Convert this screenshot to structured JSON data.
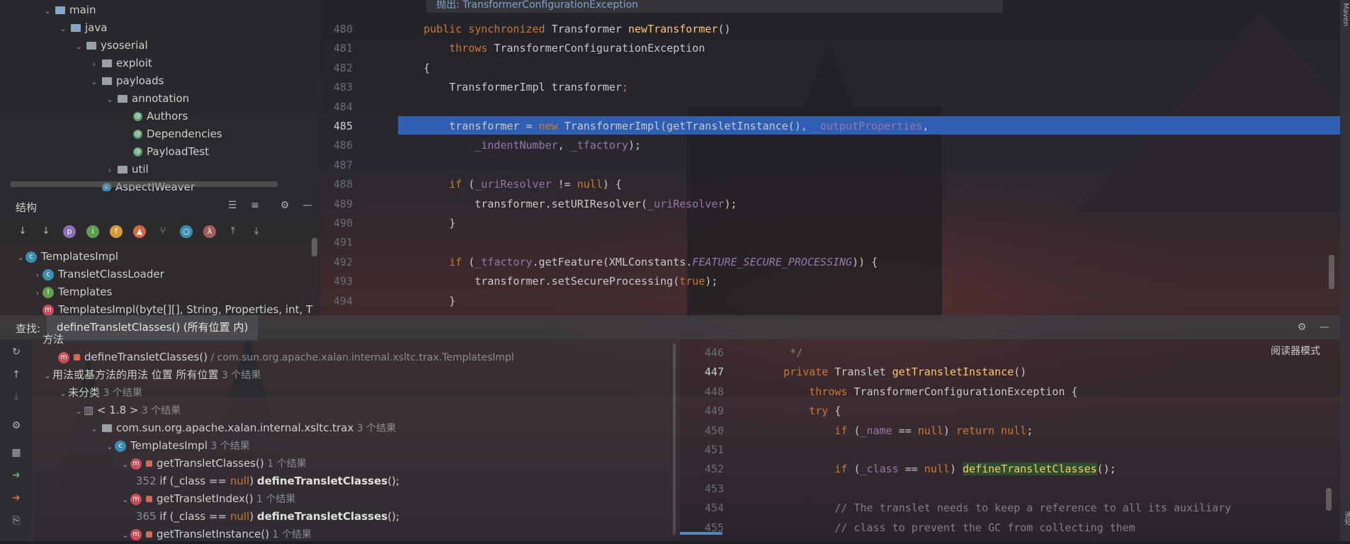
{
  "project_tree": {
    "rows": [
      {
        "label": "main",
        "indent": 0,
        "type": "folder-src",
        "open": true
      },
      {
        "label": "java",
        "indent": 1,
        "type": "folder",
        "open": true
      },
      {
        "label": "ysoserial",
        "indent": 2,
        "type": "package",
        "open": true
      },
      {
        "label": "exploit",
        "indent": 3,
        "type": "package",
        "open": false
      },
      {
        "label": "payloads",
        "indent": 3,
        "type": "package",
        "open": true
      },
      {
        "label": "annotation",
        "indent": 4,
        "type": "package",
        "open": true
      },
      {
        "label": "Authors",
        "indent": 5,
        "type": "annotation"
      },
      {
        "label": "Dependencies",
        "indent": 5,
        "type": "annotation"
      },
      {
        "label": "PayloadTest",
        "indent": 5,
        "type": "annotation"
      },
      {
        "label": "util",
        "indent": 4,
        "type": "package",
        "open": false
      },
      {
        "label": "AspectJWeaver",
        "indent": 3,
        "type": "class"
      }
    ]
  },
  "structure": {
    "title": "结构",
    "toolbar": [
      "sort-alpha",
      "sort-visibility",
      "p",
      "i",
      "f",
      "flame",
      "hierarchy",
      "circle",
      "lambda",
      "filter-up",
      "filter-down"
    ],
    "rows": [
      {
        "label": "TemplatesImpl",
        "indent": 0
      },
      {
        "label": "TransletClassLoader",
        "indent": 1
      },
      {
        "label": "Templates",
        "indent": 1
      },
      {
        "label": "TemplatesImpl(byte[][], String, Properties, int, T",
        "indent": 1
      }
    ]
  },
  "editor": {
    "tooltip": "抛出: TransformerConfigurationException",
    "lines": [
      {
        "num": "480",
        "parts": [
          [
            "kw",
            "public synchronized "
          ],
          [
            "",
            "Transformer "
          ],
          [
            "fn",
            "newTransformer"
          ],
          [
            "",
            "()"
          ]
        ]
      },
      {
        "num": "481",
        "parts": [
          [
            "",
            "    "
          ],
          [
            "kw",
            "throws "
          ],
          [
            "",
            "TransformerConfigurationException"
          ]
        ]
      },
      {
        "num": "482",
        "parts": [
          [
            "",
            "{"
          ]
        ]
      },
      {
        "num": "483",
        "parts": [
          [
            "",
            "    TransformerImpl transformer"
          ],
          [
            "kw",
            ";"
          ]
        ]
      },
      {
        "num": "484",
        "parts": [
          [
            "",
            ""
          ]
        ]
      },
      {
        "num": "485",
        "parts": [
          [
            "",
            "    transformer = "
          ],
          [
            "kw",
            "new "
          ],
          [
            "",
            "TransformerImpl(getTransletInstance(), "
          ],
          [
            "fld",
            "_outputProperties"
          ],
          [
            "",
            ","
          ]
        ]
      },
      {
        "num": "486",
        "parts": [
          [
            "",
            "        "
          ],
          [
            "fld",
            "_indentNumber"
          ],
          [
            "",
            ", "
          ],
          [
            "fld",
            "_tfactory"
          ],
          [
            "",
            ");"
          ]
        ]
      },
      {
        "num": "487",
        "parts": [
          [
            "",
            ""
          ]
        ]
      },
      {
        "num": "488",
        "parts": [
          [
            "",
            "    "
          ],
          [
            "kw",
            "if "
          ],
          [
            "",
            "("
          ],
          [
            "fld",
            "_uriResolver"
          ],
          [
            "",
            " != "
          ],
          [
            "kw",
            "null"
          ],
          [
            "",
            ") {"
          ]
        ]
      },
      {
        "num": "489",
        "parts": [
          [
            "",
            "        transformer.setURIResolver("
          ],
          [
            "fld",
            "_uriResolver"
          ],
          [
            "",
            ");"
          ]
        ]
      },
      {
        "num": "490",
        "parts": [
          [
            "",
            "    }"
          ]
        ]
      },
      {
        "num": "491",
        "parts": [
          [
            "",
            ""
          ]
        ]
      },
      {
        "num": "492",
        "parts": [
          [
            "",
            "    "
          ],
          [
            "kw",
            "if "
          ],
          [
            "",
            "("
          ],
          [
            "fld",
            "_tfactory"
          ],
          [
            "",
            ".getFeature(XMLConstants."
          ],
          [
            "fld it",
            "FEATURE_SECURE_PROCESSING"
          ],
          [
            "",
            ")) {"
          ]
        ]
      },
      {
        "num": "493",
        "parts": [
          [
            "",
            "        transformer.setSecureProcessing("
          ],
          [
            "kw",
            "true"
          ],
          [
            "",
            ");"
          ]
        ]
      },
      {
        "num": "494",
        "parts": [
          [
            "",
            "    }"
          ]
        ]
      }
    ]
  },
  "find": {
    "label": "查找:",
    "tab": "defineTransletClasses() (所有位置 内)",
    "results": [
      {
        "indent": 1,
        "text": "方法",
        "kind": "header",
        "partial": true
      },
      {
        "indent": 2,
        "kind": "method-target",
        "name": "defineTransletClasses()",
        "path": "/ com.sun.org.apache.xalan.internal.xsltc.trax.TemplatesImpl"
      },
      {
        "indent": 1,
        "kind": "group",
        "name": "用法或基方法的用法 位置 所有位置",
        "count": "3 个结果"
      },
      {
        "indent": 2,
        "kind": "group",
        "name": "未分类",
        "count": "3 个结果"
      },
      {
        "indent": 3,
        "kind": "lib",
        "name": "< 1.8 >",
        "count": "3 个结果"
      },
      {
        "indent": 4,
        "kind": "package",
        "name": "com.sun.org.apache.xalan.internal.xsltc.trax",
        "count": "3 个结果"
      },
      {
        "indent": 5,
        "kind": "class",
        "name": "TemplatesImpl",
        "count": "3 个结果"
      },
      {
        "indent": 6,
        "kind": "method",
        "name": "getTransletClasses()",
        "count": "1 个结果"
      },
      {
        "indent": 7,
        "kind": "usage",
        "line": "352",
        "code": [
          "if (_class == ",
          "null",
          ") ",
          "defineTransletClasses",
          "();"
        ]
      },
      {
        "indent": 6,
        "kind": "method",
        "name": "getTransletIndex()",
        "count": "1 个结果"
      },
      {
        "indent": 7,
        "kind": "usage",
        "line": "365",
        "code": [
          "if (_class == ",
          "null",
          ") ",
          "defineTransletClasses",
          "();"
        ]
      },
      {
        "indent": 6,
        "kind": "method",
        "name": "getTransletInstance()",
        "count": "1 个结果"
      }
    ]
  },
  "preview": {
    "reader_mode": "阅读器模式",
    "lines": [
      {
        "num": "446",
        "parts": [
          [
            "cm",
            "     */"
          ]
        ]
      },
      {
        "num": "447",
        "parts": [
          [
            "kw",
            "    private "
          ],
          [
            "",
            "Translet "
          ],
          [
            "fn",
            "getTransletInstance"
          ],
          [
            "",
            "()"
          ]
        ]
      },
      {
        "num": "448",
        "parts": [
          [
            "",
            "        "
          ],
          [
            "kw",
            "throws "
          ],
          [
            "",
            "TransformerConfigurationException {"
          ]
        ]
      },
      {
        "num": "449",
        "parts": [
          [
            "",
            "        "
          ],
          [
            "kw",
            "try "
          ],
          [
            "",
            "{"
          ]
        ]
      },
      {
        "num": "450",
        "parts": [
          [
            "",
            "            "
          ],
          [
            "kw",
            "if "
          ],
          [
            "",
            "("
          ],
          [
            "fld",
            "_name"
          ],
          [
            "",
            " == "
          ],
          [
            "kw",
            "null"
          ],
          [
            "",
            ") "
          ],
          [
            "kw",
            "return null"
          ],
          [
            "",
            ";"
          ]
        ]
      },
      {
        "num": "451",
        "parts": [
          [
            "",
            ""
          ]
        ]
      },
      {
        "num": "452",
        "parts": [
          [
            "",
            "            "
          ],
          [
            "kw",
            "if "
          ],
          [
            "",
            "("
          ],
          [
            "fld",
            "_class"
          ],
          [
            "",
            " == "
          ],
          [
            "kw",
            "null"
          ],
          [
            "",
            ") "
          ],
          [
            "defn",
            "defineTransletClasses"
          ],
          [
            "",
            "();"
          ]
        ]
      },
      {
        "num": "453",
        "parts": [
          [
            "",
            ""
          ]
        ]
      },
      {
        "num": "454",
        "parts": [
          [
            "cm",
            "            // The translet needs to keep a reference to all its auxiliary"
          ]
        ]
      },
      {
        "num": "455",
        "parts": [
          [
            "cm",
            "            // class to prevent the GC from collecting them"
          ]
        ]
      }
    ]
  },
  "right_strip": {
    "top_label": "Maven",
    "bottom_label": "通知"
  },
  "colors": {
    "selection": "#2f5fb3",
    "keyword": "#cc7832",
    "function": "#ffc66d",
    "field": "#9876aa",
    "comment": "#808080"
  }
}
